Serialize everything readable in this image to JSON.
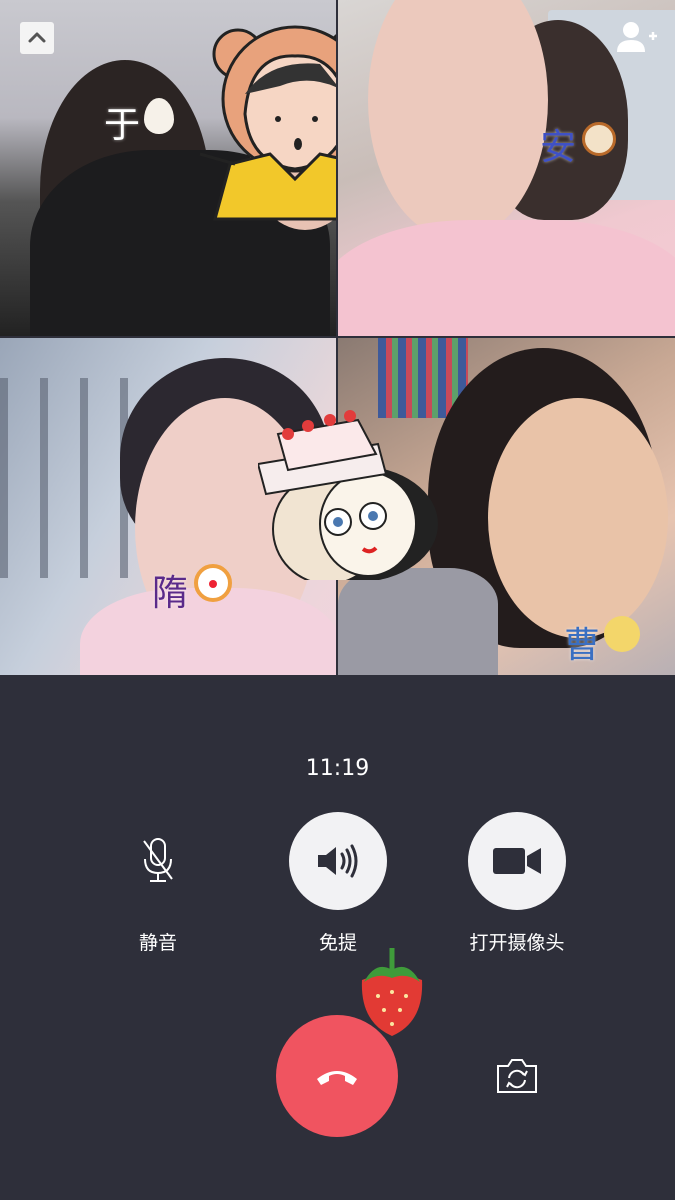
{
  "participants": [
    {
      "name": "于",
      "emoji": "egg-emoji"
    },
    {
      "name": "安",
      "emoji": "dog-face-emoji"
    },
    {
      "name": "隋",
      "emoji": "clown-face-emoji"
    },
    {
      "name": "曹",
      "emoji": "full-moon-face-emoji"
    }
  ],
  "call": {
    "duration": "11:19"
  },
  "controls": {
    "mute_label": "静音",
    "speaker_label": "免提",
    "camera_label": "打开摄像头"
  },
  "colors": {
    "background": "#2e2f3a",
    "hangup": "#f05460",
    "button_fill": "#f2f2f4",
    "icon_dark": "#2e2f3a"
  }
}
